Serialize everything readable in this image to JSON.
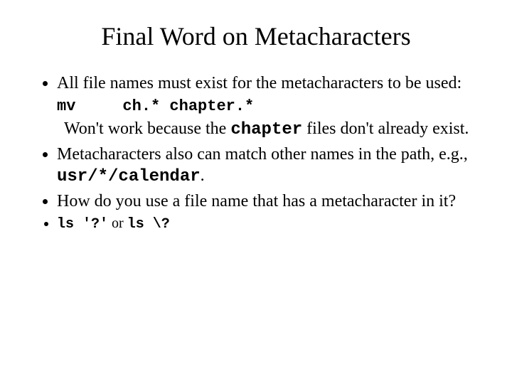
{
  "title": "Final Word on Metacharacters",
  "b1": "All file names must exist for the metacharacters to be used:",
  "code_mv": "mv",
  "code_args": "ch.* chapter.*",
  "wont_pre": "Won't work because the ",
  "wont_code": "chapter",
  "wont_post": " files don't already exist.",
  "b2_pre": "Metacharacters also can match other names in the path, e.g., ",
  "b2_code": "usr/*/calendar",
  "b2_post": ".",
  "b3": "How do you use a file name that has a metacharacter in it?",
  "b4_c1": "ls '?'",
  "b4_or": " or ",
  "b4_c2": "ls \\?"
}
